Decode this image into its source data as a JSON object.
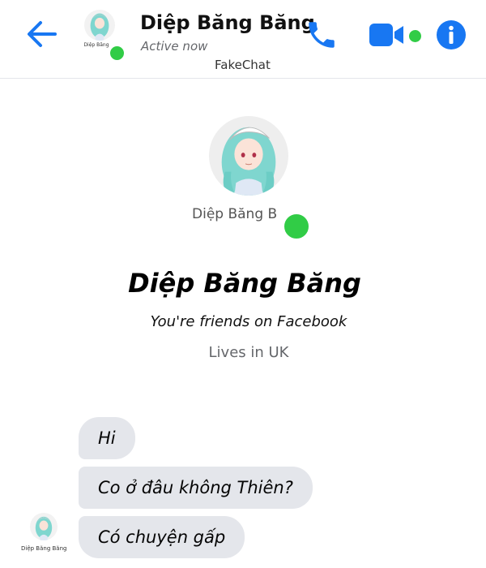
{
  "header": {
    "contact_name": "Diệp Băng Băng",
    "status": "Active now",
    "app_watermark": "FakeChat",
    "avatar_caption": "Diệp Băng",
    "icons": {
      "back": "back-arrow-icon",
      "call": "phone-icon",
      "video": "video-camera-icon",
      "info": "info-icon"
    }
  },
  "profile": {
    "caption": "Diệp Băng B",
    "name": "Diệp Băng Băng",
    "friends_text": "You're friends on Facebook",
    "location_text": "Lives in UK"
  },
  "messages": [
    {
      "text": "Hi"
    },
    {
      "text": "Co ở đâu không Thiên?"
    },
    {
      "text": "Có chuyện gấp"
    }
  ],
  "message_avatar_caption": "Diệp Băng Băng",
  "colors": {
    "accent": "#1877f2",
    "online": "#31cc46",
    "bubble": "#e4e6eb",
    "hair": "#7fd6cf"
  }
}
